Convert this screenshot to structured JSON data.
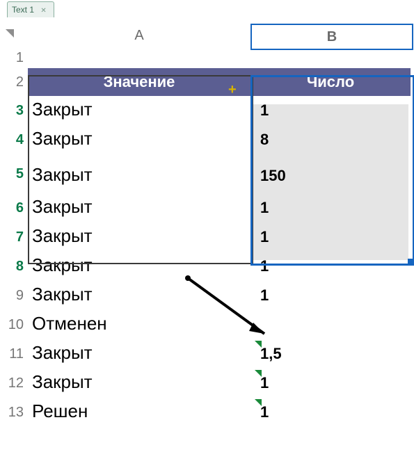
{
  "tab": {
    "label": "Text 1"
  },
  "columns": {
    "a": "A",
    "b": "B"
  },
  "header": {
    "value_label": "Значение",
    "number_label": "Число"
  },
  "rows": [
    {
      "n": "1",
      "a": "",
      "b": ""
    },
    {
      "n": "2",
      "a": "",
      "b": ""
    },
    {
      "n": "3",
      "a": "Закрыт",
      "b": "1"
    },
    {
      "n": "4",
      "a": "Закрыт",
      "b": "8"
    },
    {
      "n": "5",
      "a": "Закрыт",
      "b": "150"
    },
    {
      "n": "6",
      "a": "Закрыт",
      "b": "1"
    },
    {
      "n": "7",
      "a": "Закрыт",
      "b": "1"
    },
    {
      "n": "8",
      "a": "Закрыт",
      "b": "1"
    },
    {
      "n": "9",
      "a": "Закрыт",
      "b": "1"
    },
    {
      "n": "10",
      "a": "Отменен",
      "b": ""
    },
    {
      "n": "11",
      "a": "Закрыт",
      "b": "1,5"
    },
    {
      "n": "12",
      "a": "Закрыт",
      "b": "1"
    },
    {
      "n": "13",
      "a": "Решен",
      "b": "1"
    }
  ],
  "selection": {
    "range": "B3:B8",
    "active": "B3",
    "selected_rows": [
      3,
      4,
      5,
      6,
      7,
      8
    ]
  },
  "chart_data": {
    "type": "table",
    "title": "",
    "columns": [
      "Значение",
      "Число"
    ],
    "rows": [
      [
        "Закрыт",
        1
      ],
      [
        "Закрыт",
        8
      ],
      [
        "Закрыт",
        150
      ],
      [
        "Закрыт",
        1
      ],
      [
        "Закрыт",
        1
      ],
      [
        "Закрыт",
        1
      ],
      [
        "Закрыт",
        1
      ],
      [
        "Отменен",
        null
      ],
      [
        "Закрыт",
        1.5
      ],
      [
        "Закрыт",
        1
      ],
      [
        "Решен",
        1
      ]
    ]
  }
}
